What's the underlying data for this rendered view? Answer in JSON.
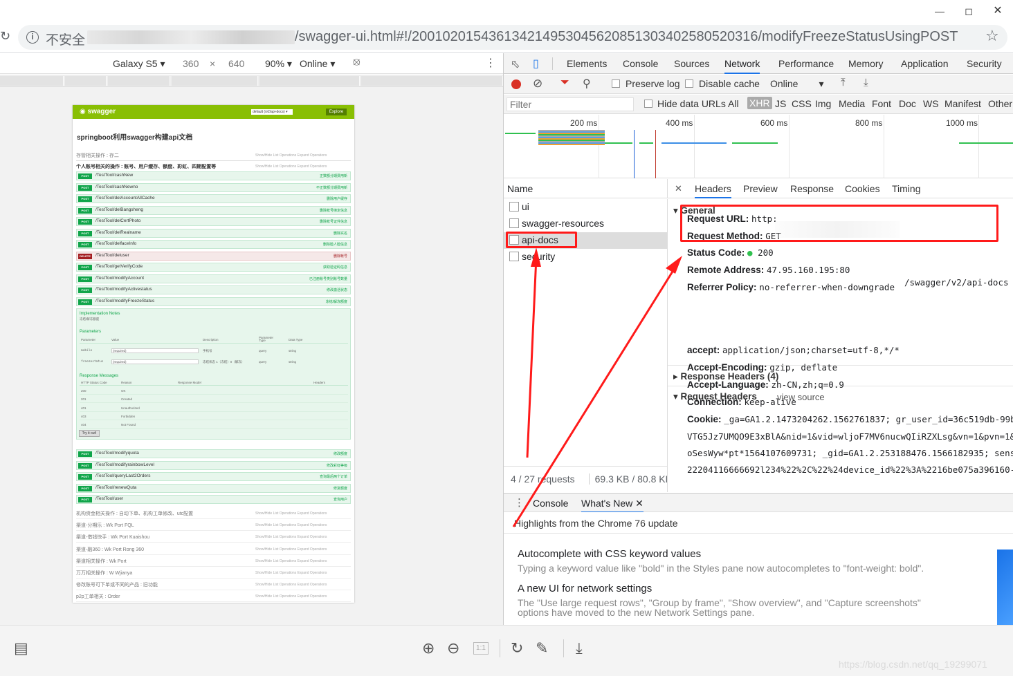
{
  "browser": {
    "insecure_label": "不安全",
    "url_tail": "/swagger-ui.html#!/20010201543613421495304562085130340258052031​6/modifyFreezeStatusUsingPOST",
    "min_icon": "minimize-icon",
    "max_icon": "maximize-icon",
    "close_icon": "close-icon"
  },
  "device_toolbar": {
    "device": "Galaxy S5",
    "width": "360",
    "times": "×",
    "height": "640",
    "zoom": "90%",
    "throttle": "Online"
  },
  "swagger": {
    "logo": "swagger",
    "select": "default (/v2/api-docs) ▾",
    "explore": "Explore",
    "title": "springboot利用swagger构建api文档",
    "section1": "存管相关操作 : 存二",
    "section2": "个人账号相关的操作 : 账号、用户缓存、额度、彩虹、四期配置等",
    "section_links": "Show/Hide  List Operations  Expand Operations",
    "endpoints": [
      {
        "method": "POST",
        "path": "/TestTool/cashNew",
        "summary": "正数额分期费用新"
      },
      {
        "method": "POST",
        "path": "/TestTool/cashNewno",
        "summary": "不正数额分期费用新"
      },
      {
        "method": "POST",
        "path": "/TestTool/delAccountAllCache",
        "summary": "删除用户缓存"
      },
      {
        "method": "POST",
        "path": "/TestTool/delBangsheng",
        "summary": "删除帐号绑定信息"
      },
      {
        "method": "POST",
        "path": "/TestTool/delCertPhoto",
        "summary": "删除帐号证件信息"
      },
      {
        "method": "POST",
        "path": "/TestTool/delRealname",
        "summary": "删除实名"
      },
      {
        "method": "POST",
        "path": "/TestTool/delfaceInfo",
        "summary": "删除脸人脸信息"
      },
      {
        "method": "DELETE",
        "path": "/TestTool/deluser",
        "summary": "删除帐号"
      },
      {
        "method": "POST",
        "path": "/TestTool/getVerifyCode",
        "summary": "获取验证码信息"
      },
      {
        "method": "POST",
        "path": "/TestTool/modifyAccount",
        "summary": "已注册账号类别账号数量"
      },
      {
        "method": "POST",
        "path": "/TestTool/modifyActivestatus",
        "summary": "修改激活状态"
      },
      {
        "method": "POST",
        "path": "/TestTool/modifyFreezeStatus",
        "summary": "冻结/解冻额度"
      }
    ],
    "impl_notes": "Implementation Notes",
    "impl_desc": "冻结/解冻额度",
    "params_title": "Parameters",
    "param_headers": [
      "Parameter",
      "Value",
      "Description",
      "Parameter Type",
      "Data Type"
    ],
    "params": [
      {
        "name": "mobile",
        "value": "(required)",
        "desc": "手机号",
        "type": "query",
        "dtype": "string"
      },
      {
        "name": "freezestatus",
        "value": "(required)",
        "desc": "冻结状态 1（冻结）0（解冻）",
        "type": "query",
        "dtype": "string"
      }
    ],
    "resp_title": "Response Messages",
    "resp_headers": [
      "HTTP Status Code",
      "Reason",
      "Response Model",
      "Headers"
    ],
    "responses": [
      {
        "code": "200",
        "reason": "OK"
      },
      {
        "code": "201",
        "reason": "Created"
      },
      {
        "code": "401",
        "reason": "Unauthorized"
      },
      {
        "code": "403",
        "reason": "Forbidden"
      },
      {
        "code": "404",
        "reason": "Not Found"
      }
    ],
    "tryit": "Try it out!",
    "endpoints2": [
      {
        "method": "POST",
        "path": "/TestTool/modifyquota",
        "summary": "修改额度"
      },
      {
        "method": "POST",
        "path": "/TestTool/modifyrainbowLevel",
        "summary": "修改彩虹等级"
      },
      {
        "method": "POST",
        "path": "/TestTool/queryLast2Orders",
        "summary": "查询最后两个订单"
      },
      {
        "method": "POST",
        "path": "/TestTool/renewQuta",
        "summary": "修复额度"
      },
      {
        "method": "POST",
        "path": "/TestTool/user",
        "summary": "查询用户"
      }
    ],
    "sections": [
      "机构资金相关操作 : 自动下单、机构工单修改、utc配置",
      "渠道-分期乐 : Wk Port FQL",
      "渠道-借钱快手 : Wk Port Kuaishou",
      "渠道-融360 : Wk Port Rong 360",
      "渠道相关操作 : Wk Port",
      "万万相关操作 : W Wjianya",
      "修改账号可下单或不同的产品 : 旧功能",
      "p2p工单相关 : Order"
    ]
  },
  "devtools": {
    "tabs": [
      "Elements",
      "Console",
      "Sources",
      "Network",
      "Performance",
      "Memory",
      "Application",
      "Security"
    ],
    "preserve_log": "Preserve log",
    "disable_cache": "Disable cache",
    "throttle": "Online",
    "filter_placeholder": "Filter",
    "hide_data_urls": "Hide data URLs",
    "types": [
      "All",
      "XHR",
      "JS",
      "CSS",
      "Img",
      "Media",
      "Font",
      "Doc",
      "WS",
      "Manifest",
      "Other"
    ],
    "timeline": [
      "200 ms",
      "400 ms",
      "600 ms",
      "800 ms",
      "1000 ms"
    ],
    "name_header": "Name",
    "requests": [
      "ui",
      "swagger-resources",
      "api-docs",
      "security"
    ],
    "status": "4 / 27 requests",
    "size": "69.3 KB / 80.8 KB tr",
    "detail_tabs": [
      "Headers",
      "Preview",
      "Response",
      "Cookies",
      "Timing"
    ],
    "general": "General",
    "general_rows": [
      {
        "k": "Request URL:",
        "v": "http:"
      },
      {
        "k": "Request Method:",
        "v": "GET"
      },
      {
        "k": "Status Code:",
        "v": "200"
      },
      {
        "k": "Remote Address:",
        "v": "47.95.160.195:80"
      },
      {
        "k": "Referrer Policy:",
        "v": "no-referrer-when-downgrade"
      }
    ],
    "url_tail": "/swagger/v2/api-docs",
    "response_headers": "Response Headers (4)",
    "request_headers": "Request Headers",
    "view_source": "view source",
    "req_rows": [
      {
        "k": "accept:",
        "v": "application/json;charset=utf-8,*/*"
      },
      {
        "k": "Accept-Encoding:",
        "v": "gzip, deflate"
      },
      {
        "k": "Accept-Language:",
        "v": "zh-CN,zh;q=0.9"
      },
      {
        "k": "Connection:",
        "v": "keep-alive"
      },
      {
        "k": "Cookie:",
        "v": "_ga=GA1.2.1473204262.1562761837; gr_user_id=36c519db-99b"
      }
    ],
    "cookie_lines": [
      "VTG5Jz7UMQO9E3xBlA&nid=1&vid=wljoF7MV6nucwQIiRZXLsg&vn=1&pvn=1&",
      "oSesWyw*pt*1564107609731; _gid=GA1.2.253188476.1566182935; sens",
      "22204116666692l234%22%2C%22%24device_id%22%3A%2216be075a396160-"
    ],
    "drawer_tabs": [
      "Console",
      "What's New"
    ],
    "drawer_heading": "Highlights from the Chrome 76 update",
    "news": [
      {
        "title": "Autocomplete with CSS keyword values",
        "body": "Typing a keyword value like \"bold\" in the Styles pane now autocompletes to \"font-weight: bold\"."
      },
      {
        "title": "A new UI for network settings",
        "body": "The \"Use large request rows\", \"Group by frame\", \"Show overview\", and \"Capture screenshots\"",
        "body2": "options have moved to the new Network Settings pane."
      }
    ]
  },
  "watermark": "https://blog.csdn.net/qq_19299071"
}
